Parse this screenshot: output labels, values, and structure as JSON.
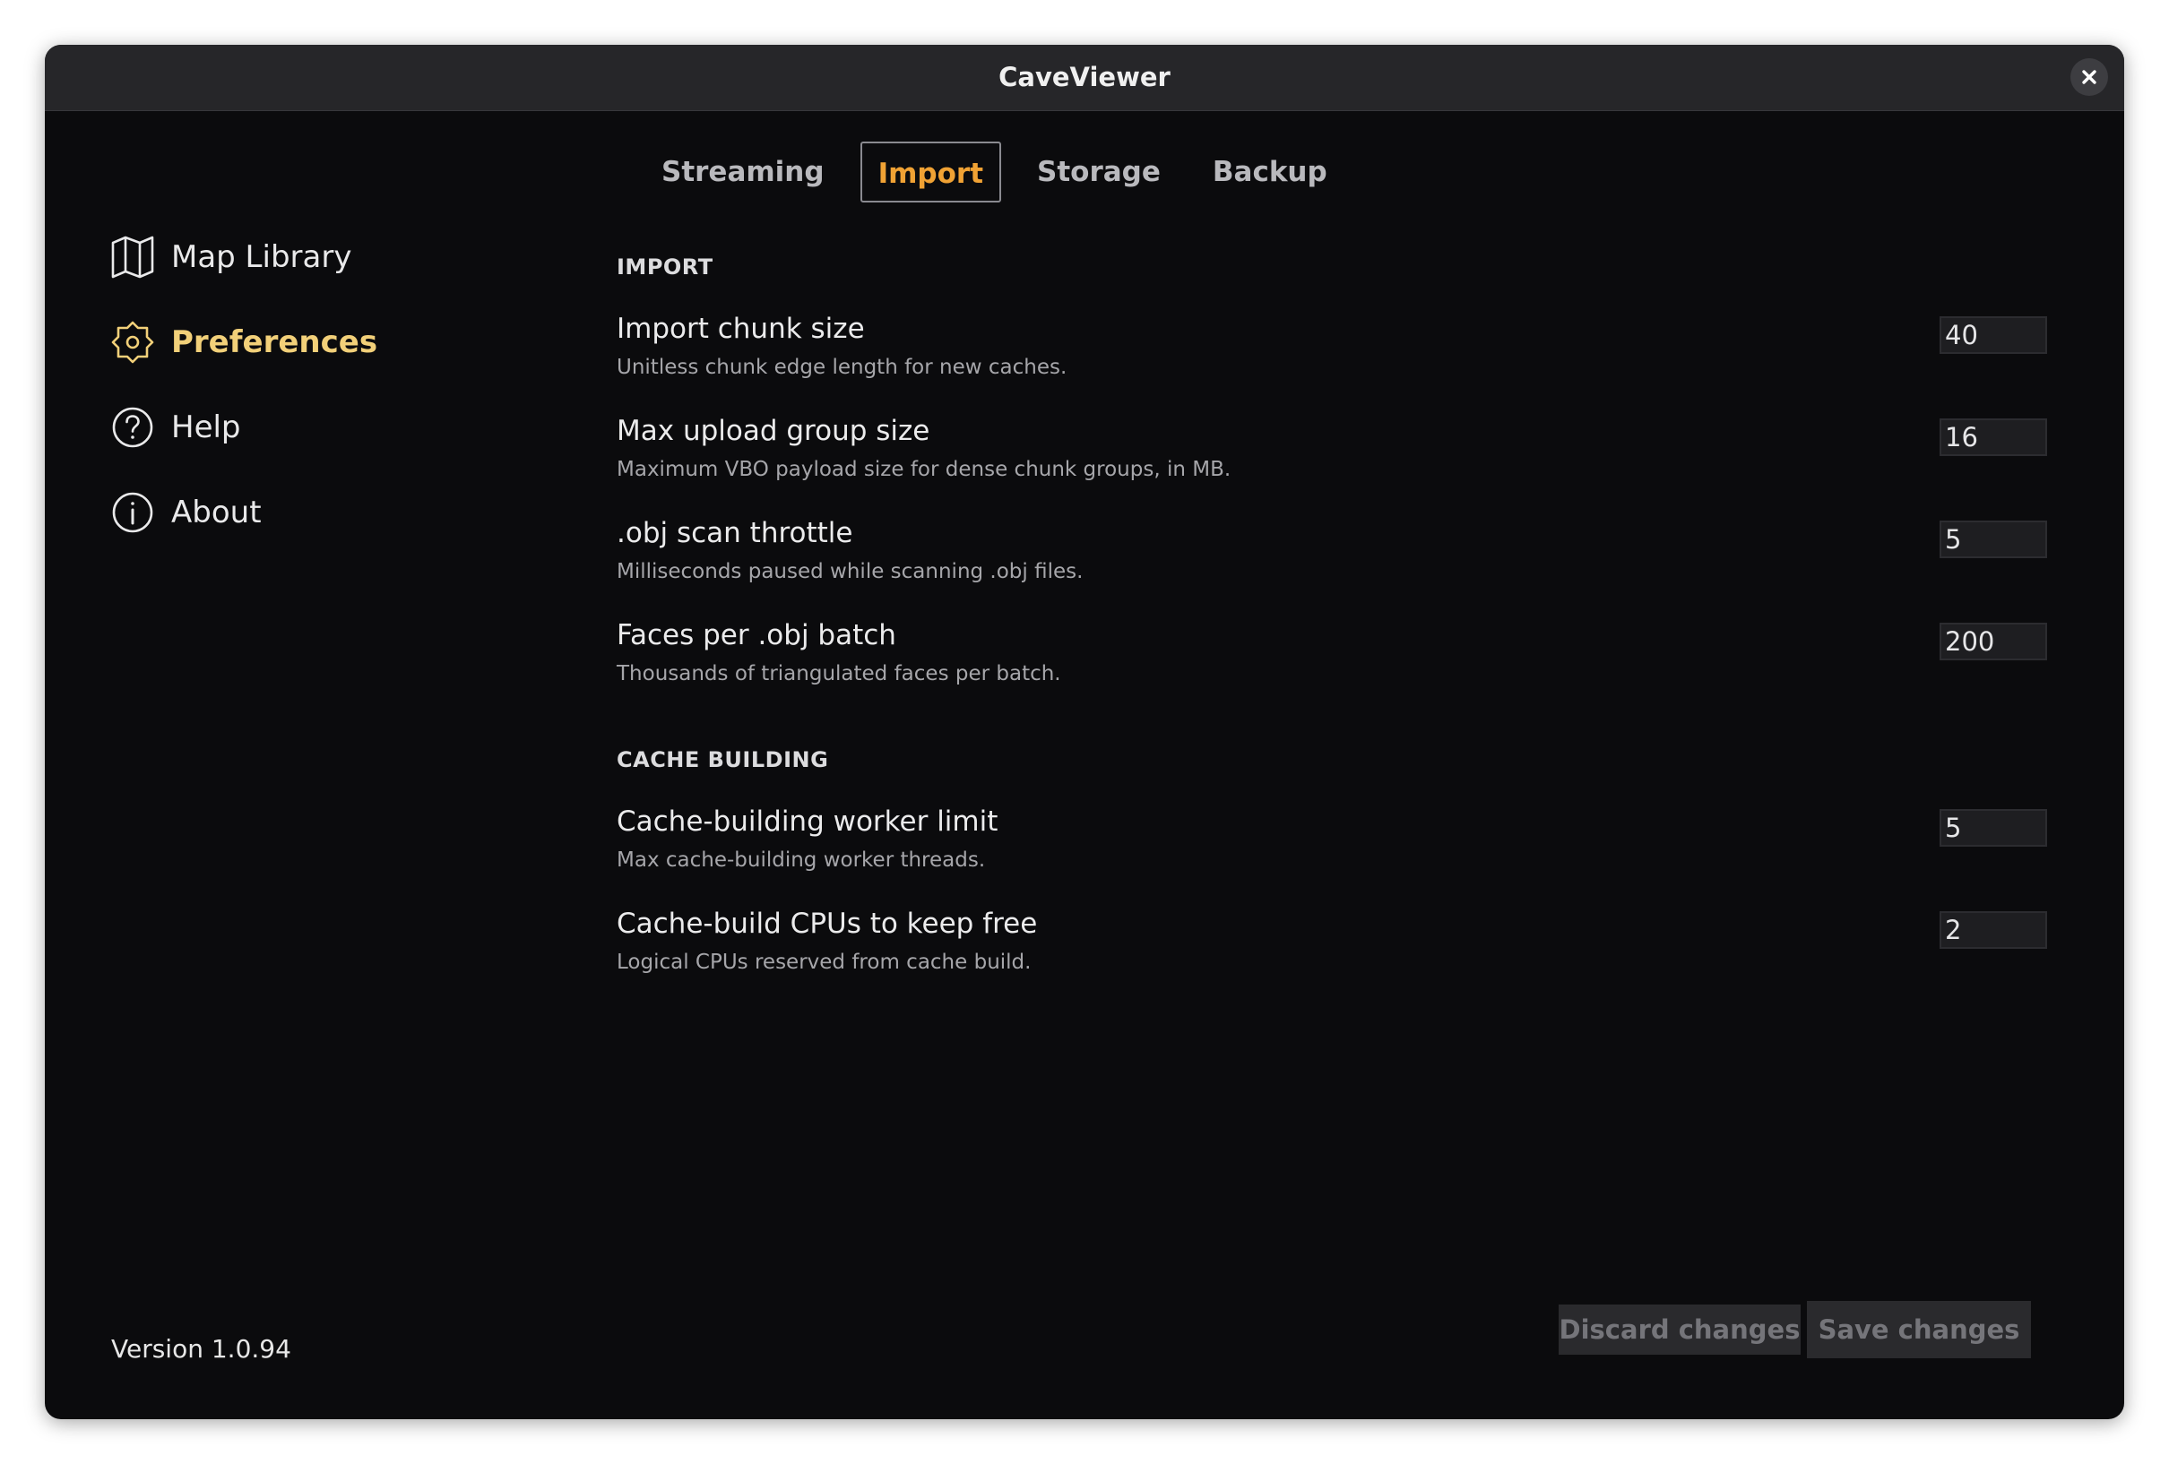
{
  "window": {
    "title": "CaveViewer"
  },
  "sidebar": {
    "items": [
      {
        "label": "Map Library",
        "icon": "map-icon",
        "active": false
      },
      {
        "label": "Preferences",
        "icon": "gear-icon",
        "active": true
      },
      {
        "label": "Help",
        "icon": "help-icon",
        "active": false
      },
      {
        "label": "About",
        "icon": "info-icon",
        "active": false
      }
    ],
    "version": "Version 1.0.94"
  },
  "tabs": [
    {
      "label": "Streaming",
      "active": false
    },
    {
      "label": "Import",
      "active": true
    },
    {
      "label": "Storage",
      "active": false
    },
    {
      "label": "Backup",
      "active": false
    }
  ],
  "sections": [
    {
      "title": "IMPORT",
      "settings": [
        {
          "label": "Import chunk size",
          "description": "Unitless chunk edge length for new caches.",
          "value": "40"
        },
        {
          "label": "Max upload group size",
          "description": "Maximum VBO payload size for dense chunk groups, in MB.",
          "value": "16"
        },
        {
          "label": ".obj scan throttle",
          "description": "Milliseconds paused while scanning .obj files.",
          "value": "5"
        },
        {
          "label": "Faces per .obj batch",
          "description": "Thousands of triangulated faces per batch.",
          "value": "200"
        }
      ]
    },
    {
      "title": "CACHE BUILDING",
      "settings": [
        {
          "label": "Cache-building worker limit",
          "description": "Max cache-building worker threads.",
          "value": "5"
        },
        {
          "label": "Cache-build CPUs to keep free",
          "description": "Logical CPUs reserved from cache build.",
          "value": "2"
        }
      ]
    }
  ],
  "footer": {
    "discard_label": "Discard changes",
    "save_label": "Save changes"
  },
  "colors": {
    "accent_active_nav": "#f2d079",
    "accent_active_tab": "#f0a234",
    "background": "#0b0b0d"
  }
}
